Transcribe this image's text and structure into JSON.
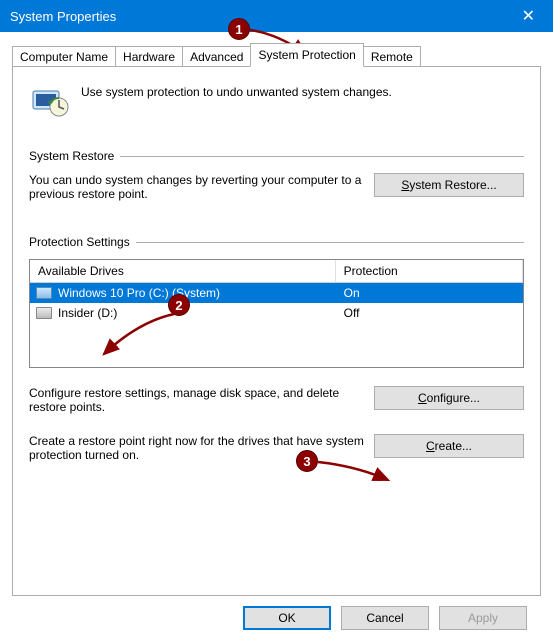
{
  "window": {
    "title": "System Properties"
  },
  "tabs": [
    "Computer Name",
    "Hardware",
    "Advanced",
    "System Protection",
    "Remote"
  ],
  "active_tab_index": 3,
  "intro_text": "Use system protection to undo unwanted system changes.",
  "system_restore": {
    "heading": "System Restore",
    "text": "You can undo system changes by reverting your computer to a previous restore point.",
    "button_prefix": "S",
    "button_rest": "ystem Restore..."
  },
  "protection_settings": {
    "heading": "Protection Settings",
    "columns": {
      "drives": "Available Drives",
      "protection": "Protection"
    },
    "rows": [
      {
        "name": "Windows 10 Pro (C:) (System)",
        "protection": "On",
        "selected": true
      },
      {
        "name": "Insider (D:)",
        "protection": "Off",
        "selected": false
      }
    ],
    "configure_text": "Configure restore settings, manage disk space, and delete restore points.",
    "configure_button_prefix": "C",
    "configure_button_rest": "onfigure...",
    "create_text": "Create a restore point right now for the drives that have system protection turned on.",
    "create_button_prefix": "C",
    "create_button_rest": "reate..."
  },
  "dialog_buttons": {
    "ok": "OK",
    "cancel": "Cancel",
    "apply": "Apply"
  },
  "annotations": {
    "badge1": "1",
    "badge2": "2",
    "badge3": "3"
  }
}
